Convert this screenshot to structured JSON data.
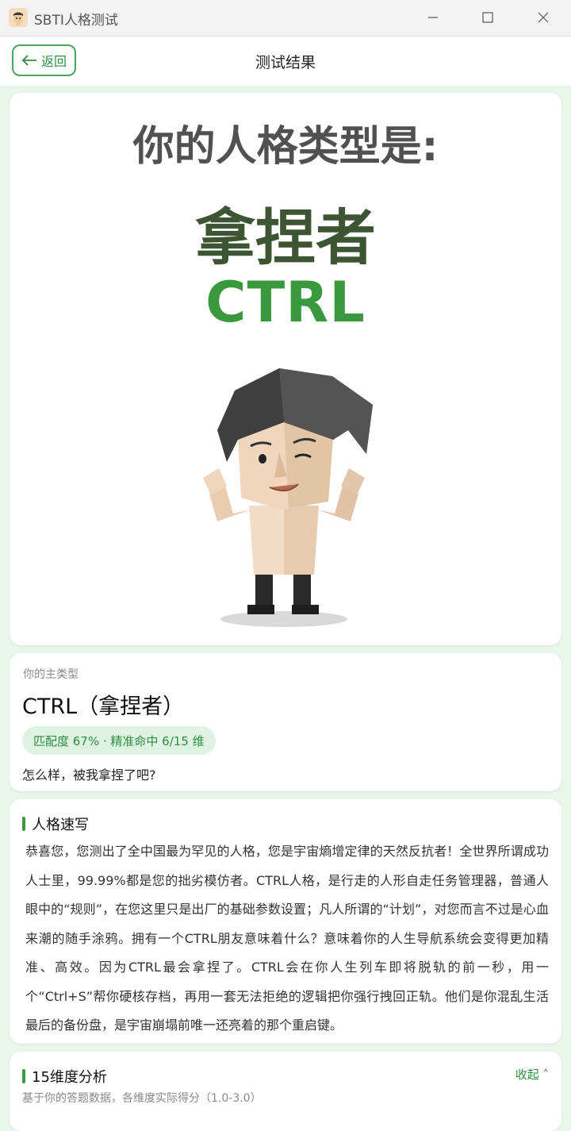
{
  "window": {
    "title": "SBTI人格测试"
  },
  "nav": {
    "back_label": "返回",
    "title": "测试结果"
  },
  "poster": {
    "line1": "你的人格类型是:",
    "name_cn": "拿捏者",
    "code": "CTRL"
  },
  "result": {
    "label": "你的主类型",
    "title": "CTRL（拿捏者）",
    "match": "匹配度 67% · 精准命中 6/15 维",
    "tagline": "怎么样，被我拿捏了吧?"
  },
  "description": {
    "heading": "人格速写",
    "text": "恭喜您，您测出了全中国最为罕见的人格，您是宇宙熵增定律的天然反抗者！全世界所谓成功人士里，99.99%都是您的拙劣模仿者。CTRL人格，是行走的人形自走任务管理器，普通人眼中的“规则”，在您这里只是出厂的基础参数设置；凡人所谓的“计划”，对您而言不过是心血来潮的随手涂鸦。拥有一个CTRL朋友意味着什么？意味着你的人生导航系统会变得更加精准、高效。因为CTRL最会拿捏了。CTRL会在你人生列车即将脱轨的前一秒，用一个“Ctrl+S”帮你硬核存档，再用一套无法拒绝的逻辑把你强行拽回正轨。他们是你混乱生活最后的备份盘，是宇宙崩塌前唯一还亮着的那个重启键。"
  },
  "dimensions": {
    "heading": "15维度分析",
    "collapse_label": "收起 ˄",
    "subtitle": "基于你的答题数据，各维度实际得分（1.0-3.0）"
  },
  "colors": {
    "accent": "#3a983d",
    "pill_bg": "#dff3e2",
    "page_bg": "#e9f6ea"
  },
  "icons": {
    "app": "mascot-app-icon",
    "back": "arrow-left-icon",
    "minimize": "minimize-icon",
    "maximize": "maximize-icon",
    "close": "close-icon"
  }
}
